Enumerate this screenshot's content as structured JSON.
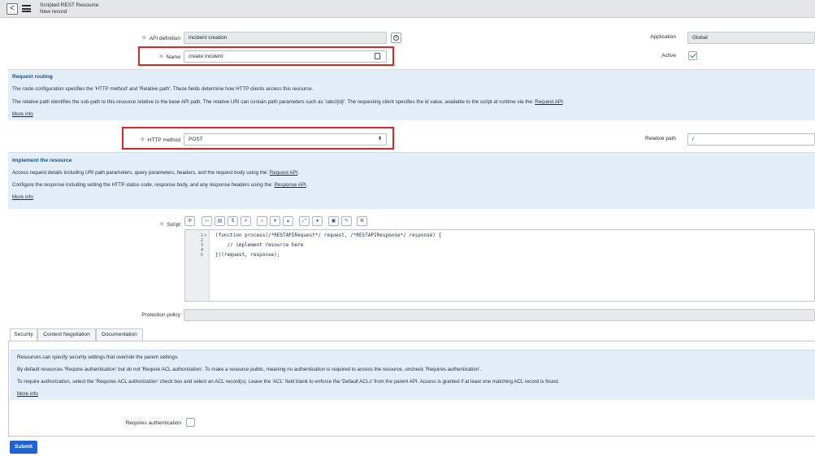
{
  "header": {
    "back_label": "<",
    "title": "Scripted REST Resource",
    "subtitle": "New record"
  },
  "form": {
    "api_definition": {
      "label": "API definition",
      "value": "incident creation"
    },
    "name": {
      "label": "Name",
      "value": "create incident"
    },
    "application": {
      "label": "Application",
      "value": "Global"
    },
    "active": {
      "label": "Active",
      "checked": true
    },
    "http_method": {
      "label": "HTTP method",
      "value": "POST"
    },
    "relative_path": {
      "label": "Relative path",
      "value": "/"
    },
    "script_label": "Script",
    "protection_policy": {
      "label": "Protection policy",
      "value": ""
    },
    "requires_auth": {
      "label": "Requires authentication",
      "checked": false
    }
  },
  "request_routing": {
    "title": "Request routing",
    "line1": "The route configuration specifies the 'HTTP method' and 'Relative path'. These fields determine how HTTP clients access this resource.",
    "line2": "The relative path identifies the sub-path to this resource relative to the base API path. The relative URI can contain path parameters such as '/abc/{id}'. The requesting client specifies the id value, available to the script at runtime via the:",
    "line2_link": "Request API",
    "line2_end": ".",
    "more_info": "More info"
  },
  "implement": {
    "title": "Implement the resource",
    "line1": "Access request details including URI path parameters, query parameters, headers, and the request body using the:",
    "line1_link": "Request API",
    "line1_end": ".",
    "line2": "Configure the response including setting the HTTP status code, response body, and any response headers using the:",
    "line2_link": "Response API",
    "line2_end": ".",
    "more_info": "More info"
  },
  "script": {
    "line_numbers": [
      "1",
      "2",
      "3",
      "4",
      "5"
    ],
    "fold_marker": "▾",
    "lines": [
      "(function process(/*RESTAPIRequest*/ request, /*RESTAPIResponse*/ response) {",
      "",
      "    // implement resource here",
      "",
      "})(request, response);"
    ],
    "toolbar_icons": [
      "script-icon",
      "comment-icon",
      "format-icon",
      "replace-icon",
      "replace-all-icon",
      "search-icon",
      "down-arrow-icon",
      "up-arrow-icon",
      "fullscreen-icon",
      "help-icon",
      "save-icon",
      "toggle-syntax-icon",
      "debug-icon"
    ]
  },
  "tabs": [
    {
      "label": "Security",
      "active": true
    },
    {
      "label": "Content Negotiation",
      "active": false
    },
    {
      "label": "Documentation",
      "active": false
    }
  ],
  "security": {
    "line1": "Resources can specify security settings that override the parent settings.",
    "line2": "By default resources 'Require authentication' but do not 'Require ACL authorization'. To make a resource public, meaning no authentication is required to access the resource, uncheck 'Requires authentication'.",
    "line3": "To require authorization, select the 'Requires ACL authorization' check box and select an ACL record(s). Leave the 'ACL' field blank to enforce the 'Default ACLs' from the parent API. Access is granted if at least one matching ACL record is found.",
    "more_info": "More info"
  },
  "submit_label": "Submit",
  "colors": {
    "accent": "#1f62d6",
    "highlight": "#e02424",
    "panel": "#e4eef9"
  }
}
